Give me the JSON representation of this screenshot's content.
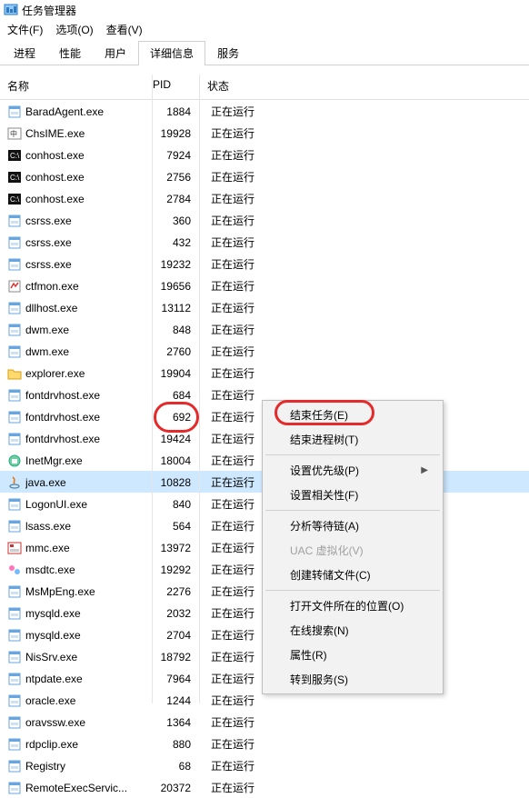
{
  "window": {
    "title": "任务管理器"
  },
  "menu": {
    "file": "文件(F)",
    "options": "选项(O)",
    "view": "查看(V)"
  },
  "tabs": {
    "processes": "进程",
    "performance": "性能",
    "users": "用户",
    "details": "详细信息",
    "services": "服务"
  },
  "headers": {
    "name": "名称",
    "pid": "PID",
    "status": "状态"
  },
  "status_running": "正在运行",
  "processes": [
    {
      "name": "BaradAgent.exe",
      "pid": "1884",
      "icon": "app"
    },
    {
      "name": "ChsIME.exe",
      "pid": "19928",
      "icon": "ime"
    },
    {
      "name": "conhost.exe",
      "pid": "7924",
      "icon": "con"
    },
    {
      "name": "conhost.exe",
      "pid": "2756",
      "icon": "con"
    },
    {
      "name": "conhost.exe",
      "pid": "2784",
      "icon": "con"
    },
    {
      "name": "csrss.exe",
      "pid": "360",
      "icon": "app"
    },
    {
      "name": "csrss.exe",
      "pid": "432",
      "icon": "app"
    },
    {
      "name": "csrss.exe",
      "pid": "19232",
      "icon": "app"
    },
    {
      "name": "ctfmon.exe",
      "pid": "19656",
      "icon": "ctf"
    },
    {
      "name": "dllhost.exe",
      "pid": "13112",
      "icon": "app"
    },
    {
      "name": "dwm.exe",
      "pid": "848",
      "icon": "app"
    },
    {
      "name": "dwm.exe",
      "pid": "2760",
      "icon": "app"
    },
    {
      "name": "explorer.exe",
      "pid": "19904",
      "icon": "folder"
    },
    {
      "name": "fontdrvhost.exe",
      "pid": "684",
      "icon": "app"
    },
    {
      "name": "fontdrvhost.exe",
      "pid": "692",
      "icon": "app"
    },
    {
      "name": "fontdrvhost.exe",
      "pid": "19424",
      "icon": "app"
    },
    {
      "name": "InetMgr.exe",
      "pid": "18004",
      "icon": "inet"
    },
    {
      "name": "java.exe",
      "pid": "10828",
      "icon": "java",
      "selected": true
    },
    {
      "name": "LogonUI.exe",
      "pid": "840",
      "icon": "app"
    },
    {
      "name": "lsass.exe",
      "pid": "564",
      "icon": "app"
    },
    {
      "name": "mmc.exe",
      "pid": "13972",
      "icon": "mmc"
    },
    {
      "name": "msdtc.exe",
      "pid": "19292",
      "icon": "msdtc"
    },
    {
      "name": "MsMpEng.exe",
      "pid": "2276",
      "icon": "app"
    },
    {
      "name": "mysqld.exe",
      "pid": "2032",
      "icon": "app"
    },
    {
      "name": "mysqld.exe",
      "pid": "2704",
      "icon": "app"
    },
    {
      "name": "NisSrv.exe",
      "pid": "18792",
      "icon": "app"
    },
    {
      "name": "ntpdate.exe",
      "pid": "7964",
      "icon": "app"
    },
    {
      "name": "oracle.exe",
      "pid": "1244",
      "icon": "app"
    },
    {
      "name": "oravssw.exe",
      "pid": "1364",
      "icon": "app"
    },
    {
      "name": "rdpclip.exe",
      "pid": "880",
      "icon": "app"
    },
    {
      "name": "Registry",
      "pid": "68",
      "icon": "app"
    },
    {
      "name": "RemoteExecServic...",
      "pid": "20372",
      "icon": "app"
    }
  ],
  "ctx": {
    "end_task": "结束任务(E)",
    "end_tree": "结束进程树(T)",
    "priority": "设置优先级(P)",
    "affinity": "设置相关性(F)",
    "analyze": "分析等待链(A)",
    "uac": "UAC 虚拟化(V)",
    "dump": "创建转储文件(C)",
    "open_loc": "打开文件所在的位置(O)",
    "search": "在线搜索(N)",
    "properties": "属性(R)",
    "goto_service": "转到服务(S)"
  }
}
